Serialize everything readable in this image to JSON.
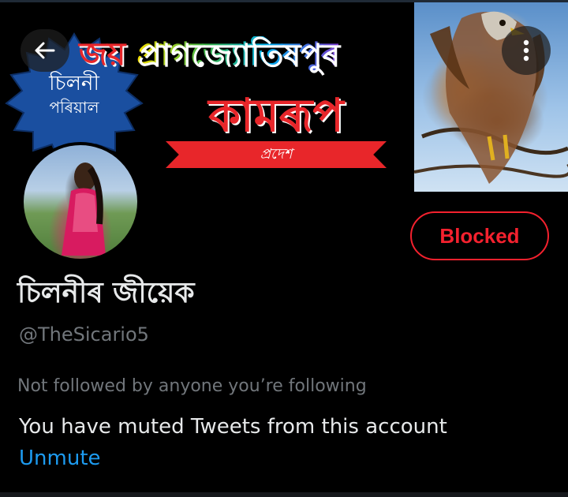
{
  "banner": {
    "title_joy": "জয়",
    "title_rest": "প্ৰাগজ্যোতিষপুৰ",
    "kamrup": "কামৰূপ",
    "pradesh": "প্ৰদেশ",
    "badge_line1": "চিলনী",
    "badge_line2": "পৰিয়াল",
    "badge_color": "#1a4fa0"
  },
  "nav": {
    "back_icon": "arrow-left-icon",
    "more_icon": "more-vertical-icon"
  },
  "profile": {
    "display_name": "চিলনীৰ জীয়েক",
    "handle": "@TheSicario5",
    "blocked_label": "Blocked",
    "not_followed_text": "Not followed by anyone you’re following",
    "muted_text": "You have muted Tweets from this account",
    "unmute_label": "Unmute"
  },
  "colors": {
    "background": "#000000",
    "primary_text": "#e7e9ea",
    "secondary_text": "#71767b",
    "blocked_red": "#f4212e",
    "link_blue": "#1d9bf0"
  }
}
